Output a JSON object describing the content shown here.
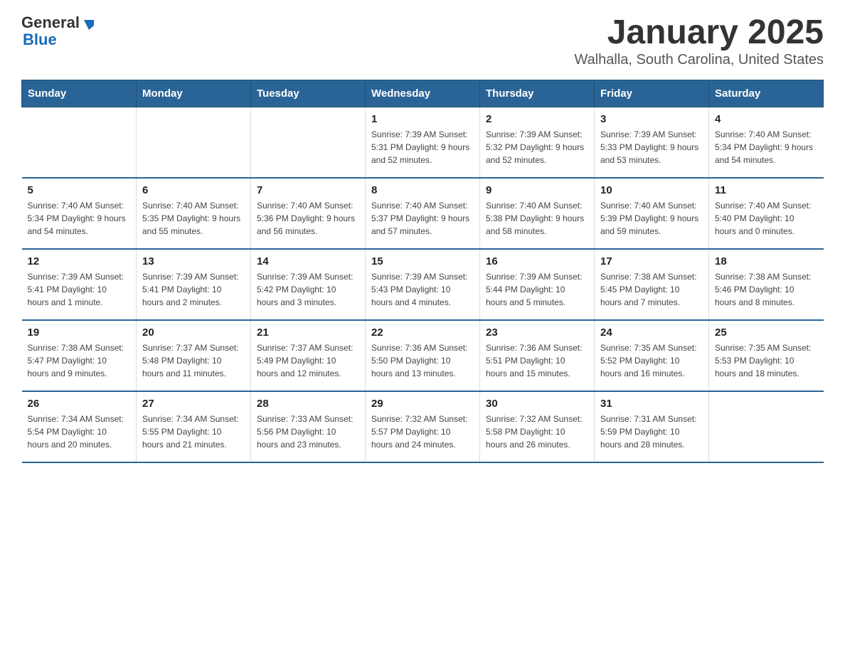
{
  "header": {
    "logo_general": "General",
    "logo_blue": "Blue",
    "month": "January 2025",
    "location": "Walhalla, South Carolina, United States"
  },
  "days_of_week": [
    "Sunday",
    "Monday",
    "Tuesday",
    "Wednesday",
    "Thursday",
    "Friday",
    "Saturday"
  ],
  "weeks": [
    [
      {
        "day": "",
        "info": ""
      },
      {
        "day": "",
        "info": ""
      },
      {
        "day": "",
        "info": ""
      },
      {
        "day": "1",
        "info": "Sunrise: 7:39 AM\nSunset: 5:31 PM\nDaylight: 9 hours\nand 52 minutes."
      },
      {
        "day": "2",
        "info": "Sunrise: 7:39 AM\nSunset: 5:32 PM\nDaylight: 9 hours\nand 52 minutes."
      },
      {
        "day": "3",
        "info": "Sunrise: 7:39 AM\nSunset: 5:33 PM\nDaylight: 9 hours\nand 53 minutes."
      },
      {
        "day": "4",
        "info": "Sunrise: 7:40 AM\nSunset: 5:34 PM\nDaylight: 9 hours\nand 54 minutes."
      }
    ],
    [
      {
        "day": "5",
        "info": "Sunrise: 7:40 AM\nSunset: 5:34 PM\nDaylight: 9 hours\nand 54 minutes."
      },
      {
        "day": "6",
        "info": "Sunrise: 7:40 AM\nSunset: 5:35 PM\nDaylight: 9 hours\nand 55 minutes."
      },
      {
        "day": "7",
        "info": "Sunrise: 7:40 AM\nSunset: 5:36 PM\nDaylight: 9 hours\nand 56 minutes."
      },
      {
        "day": "8",
        "info": "Sunrise: 7:40 AM\nSunset: 5:37 PM\nDaylight: 9 hours\nand 57 minutes."
      },
      {
        "day": "9",
        "info": "Sunrise: 7:40 AM\nSunset: 5:38 PM\nDaylight: 9 hours\nand 58 minutes."
      },
      {
        "day": "10",
        "info": "Sunrise: 7:40 AM\nSunset: 5:39 PM\nDaylight: 9 hours\nand 59 minutes."
      },
      {
        "day": "11",
        "info": "Sunrise: 7:40 AM\nSunset: 5:40 PM\nDaylight: 10 hours\nand 0 minutes."
      }
    ],
    [
      {
        "day": "12",
        "info": "Sunrise: 7:39 AM\nSunset: 5:41 PM\nDaylight: 10 hours\nand 1 minute."
      },
      {
        "day": "13",
        "info": "Sunrise: 7:39 AM\nSunset: 5:41 PM\nDaylight: 10 hours\nand 2 minutes."
      },
      {
        "day": "14",
        "info": "Sunrise: 7:39 AM\nSunset: 5:42 PM\nDaylight: 10 hours\nand 3 minutes."
      },
      {
        "day": "15",
        "info": "Sunrise: 7:39 AM\nSunset: 5:43 PM\nDaylight: 10 hours\nand 4 minutes."
      },
      {
        "day": "16",
        "info": "Sunrise: 7:39 AM\nSunset: 5:44 PM\nDaylight: 10 hours\nand 5 minutes."
      },
      {
        "day": "17",
        "info": "Sunrise: 7:38 AM\nSunset: 5:45 PM\nDaylight: 10 hours\nand 7 minutes."
      },
      {
        "day": "18",
        "info": "Sunrise: 7:38 AM\nSunset: 5:46 PM\nDaylight: 10 hours\nand 8 minutes."
      }
    ],
    [
      {
        "day": "19",
        "info": "Sunrise: 7:38 AM\nSunset: 5:47 PM\nDaylight: 10 hours\nand 9 minutes."
      },
      {
        "day": "20",
        "info": "Sunrise: 7:37 AM\nSunset: 5:48 PM\nDaylight: 10 hours\nand 11 minutes."
      },
      {
        "day": "21",
        "info": "Sunrise: 7:37 AM\nSunset: 5:49 PM\nDaylight: 10 hours\nand 12 minutes."
      },
      {
        "day": "22",
        "info": "Sunrise: 7:36 AM\nSunset: 5:50 PM\nDaylight: 10 hours\nand 13 minutes."
      },
      {
        "day": "23",
        "info": "Sunrise: 7:36 AM\nSunset: 5:51 PM\nDaylight: 10 hours\nand 15 minutes."
      },
      {
        "day": "24",
        "info": "Sunrise: 7:35 AM\nSunset: 5:52 PM\nDaylight: 10 hours\nand 16 minutes."
      },
      {
        "day": "25",
        "info": "Sunrise: 7:35 AM\nSunset: 5:53 PM\nDaylight: 10 hours\nand 18 minutes."
      }
    ],
    [
      {
        "day": "26",
        "info": "Sunrise: 7:34 AM\nSunset: 5:54 PM\nDaylight: 10 hours\nand 20 minutes."
      },
      {
        "day": "27",
        "info": "Sunrise: 7:34 AM\nSunset: 5:55 PM\nDaylight: 10 hours\nand 21 minutes."
      },
      {
        "day": "28",
        "info": "Sunrise: 7:33 AM\nSunset: 5:56 PM\nDaylight: 10 hours\nand 23 minutes."
      },
      {
        "day": "29",
        "info": "Sunrise: 7:32 AM\nSunset: 5:57 PM\nDaylight: 10 hours\nand 24 minutes."
      },
      {
        "day": "30",
        "info": "Sunrise: 7:32 AM\nSunset: 5:58 PM\nDaylight: 10 hours\nand 26 minutes."
      },
      {
        "day": "31",
        "info": "Sunrise: 7:31 AM\nSunset: 5:59 PM\nDaylight: 10 hours\nand 28 minutes."
      },
      {
        "day": "",
        "info": ""
      }
    ]
  ]
}
